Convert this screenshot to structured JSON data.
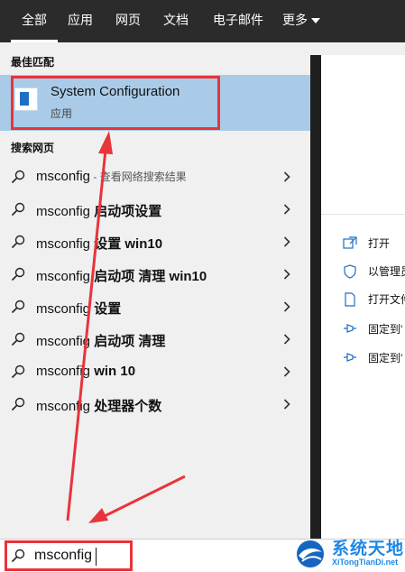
{
  "tabs": [
    {
      "label": "全部",
      "active": true
    },
    {
      "label": "应用",
      "active": false
    },
    {
      "label": "网页",
      "active": false
    },
    {
      "label": "文档",
      "active": false
    },
    {
      "label": "电子邮件",
      "active": false
    },
    {
      "label": "更多",
      "active": false
    }
  ],
  "sections": {
    "best_match": "最佳匹配",
    "web_search": "搜索网页"
  },
  "best_match": {
    "title": "System Configuration",
    "subtitle": "应用",
    "icon": "system-configuration-icon"
  },
  "web_results": [
    {
      "query": "msconfig",
      "suffix": "",
      "hint": " - 查看网络搜索结果"
    },
    {
      "query": "msconfig",
      "suffix": " 启动项设置",
      "hint": ""
    },
    {
      "query": "msconfig",
      "suffix": " 设置 win10",
      "hint": ""
    },
    {
      "query": "msconfig",
      "suffix": " 启动项 清理 win10",
      "hint": ""
    },
    {
      "query": "msconfig",
      "suffix": " 设置",
      "hint": ""
    },
    {
      "query": "msconfig",
      "suffix": " 启动项 清理",
      "hint": ""
    },
    {
      "query": "msconfig",
      "suffix": " win 10",
      "hint": ""
    },
    {
      "query": "msconfig",
      "suffix": " 处理器个数",
      "hint": ""
    }
  ],
  "actions": [
    {
      "label": "打开",
      "icon": "open-icon"
    },
    {
      "label": "以管理员",
      "icon": "admin-shield-icon"
    },
    {
      "label": "打开文件",
      "icon": "open-file-location-icon"
    },
    {
      "label": "固定到'",
      "icon": "pin-start-icon"
    },
    {
      "label": "固定到'",
      "icon": "pin-taskbar-icon"
    }
  ],
  "search": {
    "value": "msconfig",
    "placeholder": ""
  },
  "watermark": {
    "title": "系统天地",
    "subtitle": "XiTongTianDi.net"
  },
  "colors": {
    "tabbar_bg": "#2b2b2b",
    "best_match_bg": "#a9cbe8",
    "annotation_red": "#e8343a",
    "watermark_blue": "#1e88e5"
  }
}
